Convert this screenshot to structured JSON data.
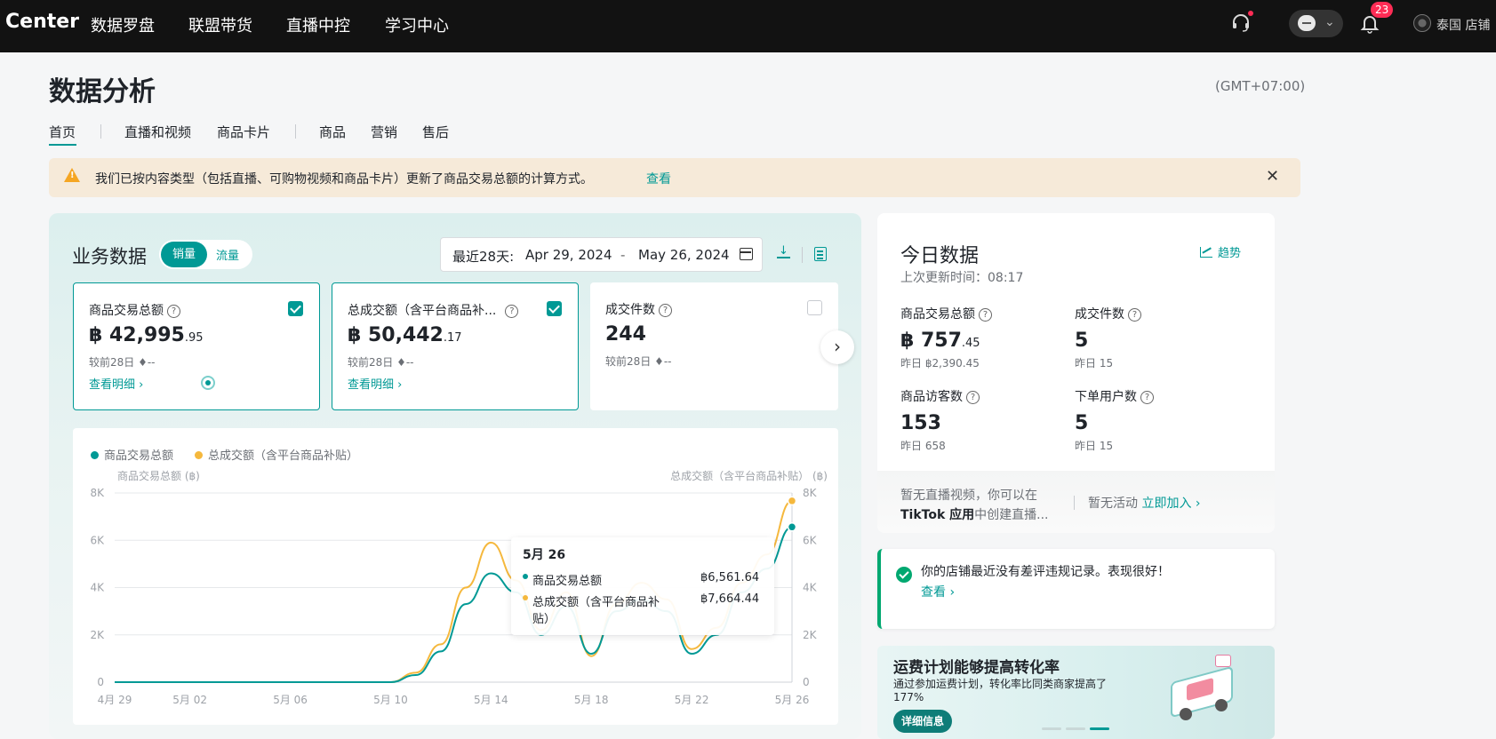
{
  "topbar": {
    "brand": "Center",
    "nav": [
      "数据罗盘",
      "联盟带货",
      "直播中控",
      "学习中心"
    ],
    "notification_count": "23",
    "store_name": "泰国 店铺"
  },
  "page": {
    "title": "数据分析",
    "timezone": "(GMT+07:00)",
    "tabs": [
      "首页",
      "直播和视频",
      "商品卡片",
      "商品",
      "营销",
      "售后"
    ]
  },
  "notice": {
    "text": "我们已按内容类型（包括直播、可购物视频和商品卡片）更新了商品交易总额的计算方式。",
    "link": "查看"
  },
  "business": {
    "title": "业务数据",
    "toggle_on": "销量",
    "toggle_off": "流量",
    "date_label": "最近28天:",
    "date_start": "Apr 29, 2024",
    "date_dash": "-",
    "date_end": "May 26, 2024",
    "cards": [
      {
        "label": "商品交易总额",
        "currency": "฿ ",
        "int": "42,995",
        "dec": ".95",
        "compare": "较前28日  ♦--",
        "link": "查看明细 ›",
        "checked": true
      },
      {
        "label": "总成交额（含平台商品补...",
        "currency": "฿ ",
        "int": "50,442",
        "dec": ".17",
        "compare": "较前28日  ♦--",
        "link": "查看明细 ›",
        "checked": true
      },
      {
        "label": "成交件数",
        "currency": "",
        "int": "244",
        "dec": "",
        "compare": "较前28日  ♦--",
        "link": "",
        "checked": false
      }
    ]
  },
  "chart_legend": {
    "series1": "商品交易总额",
    "series2": "总成交额（含平台商品补贴）",
    "left_axis_title": "商品交易总额 (฿)",
    "right_axis_title": "总成交额（含平台商品补贴） (฿)"
  },
  "tooltip": {
    "date": "5月 26",
    "row1_name": "商品交易总额",
    "row1_value": "฿6,561.64",
    "row2_name": "总成交额（含平台商品补贴）",
    "row2_value": "฿7,664.44"
  },
  "chart_data": {
    "type": "line",
    "x_ticks": [
      "4月 29",
      "5月 02",
      "5月 06",
      "5月 10",
      "5月 14",
      "5月 18",
      "5月 22",
      "5月 26"
    ],
    "y_ticks": [
      "0",
      "2K",
      "4K",
      "6K",
      "8K"
    ],
    "ylim": [
      0,
      8000
    ],
    "grid": true,
    "legend_position": "top-left",
    "x": [
      "4月 29",
      "4月 30",
      "5月 01",
      "5月 02",
      "5月 03",
      "5月 04",
      "5月 05",
      "5月 06",
      "5月 07",
      "5月 08",
      "5月 09",
      "5月 10",
      "5月 11",
      "5月 12",
      "5月 13",
      "5月 14",
      "5月 15",
      "5月 16",
      "5月 17",
      "5月 18",
      "5月 19",
      "5月 20",
      "5月 21",
      "5月 22",
      "5月 23",
      "5月 24",
      "5月 25",
      "5月 26"
    ],
    "series": [
      {
        "name": "商品交易总额",
        "color": "#009995",
        "values": [
          0,
          0,
          0,
          0,
          0,
          0,
          0,
          0,
          0,
          0,
          0,
          0,
          300,
          1300,
          3300,
          4600,
          3800,
          2000,
          3200,
          1200,
          3000,
          3500,
          3000,
          1200,
          2000,
          3800,
          4800,
          6561.64
        ]
      },
      {
        "name": "总成交额（含平台商品补贴）",
        "color": "#f5b83d",
        "values": [
          0,
          0,
          0,
          0,
          0,
          0,
          0,
          0,
          0,
          0,
          0,
          0,
          400,
          1600,
          4000,
          5900,
          4300,
          2200,
          3800,
          1100,
          3300,
          4200,
          3500,
          1400,
          2300,
          4200,
          5400,
          7664.44
        ]
      }
    ]
  },
  "today": {
    "title": "今日数据",
    "trend": "趋势",
    "updated": "上次更新时间：08:17",
    "metrics": [
      {
        "label": "商品交易总额",
        "currency": "฿ ",
        "int": "757",
        "dec": ".45",
        "yesterday": "昨日 ฿2,390.45"
      },
      {
        "label": "成交件数",
        "currency": "",
        "int": "5",
        "dec": "",
        "yesterday": "昨日 15"
      },
      {
        "label": "商品访客数",
        "currency": "",
        "int": "153",
        "dec": "",
        "yesterday": "昨日 658"
      },
      {
        "label": "下单用户数",
        "currency": "",
        "int": "5",
        "dec": "",
        "yesterday": "昨日 15"
      }
    ],
    "live_text_1": "暂无直播视频，你可以在",
    "live_text_bold": "TikTok 应用",
    "live_text_2": "中创建直播...",
    "activity_text": "暂无活动",
    "activity_link": "立即加入 ›"
  },
  "shop_status": {
    "text": "你的店铺最近没有差评违规记录。表现很好！",
    "link": "查看  ›"
  },
  "promo": {
    "title": "运费计划能够提高转化率",
    "subtitle": "通过参加运费计划，转化率比同类商家提高了177%",
    "button": "详细信息"
  },
  "colors": {
    "accent": "#009995",
    "series1": "#009995",
    "series2": "#f5b83d",
    "topbar": "#121212",
    "notice_bg": "#f6ead9",
    "success": "#00a870"
  }
}
